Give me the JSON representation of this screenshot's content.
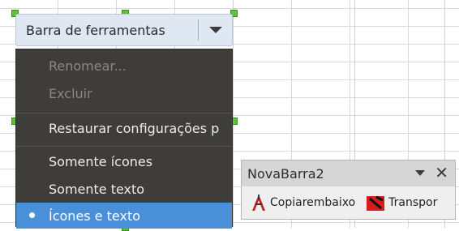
{
  "toolbar_combo": {
    "label": "Barra de ferramentas"
  },
  "menu": {
    "items": [
      {
        "text": "Renomear...",
        "state": "disabled"
      },
      {
        "text": "Excluir",
        "state": "disabled"
      },
      {
        "text": "Restaurar configurações p",
        "state": "enabled"
      },
      {
        "text": "Somente ícones",
        "state": "enabled"
      },
      {
        "text": "Somente texto",
        "state": "enabled"
      },
      {
        "text": "Ícones e texto",
        "state": "selected"
      }
    ]
  },
  "float_toolbar": {
    "title": "NovaBarra2",
    "tools": [
      {
        "icon": "copy-down-icon",
        "label": "Copiarembaixo"
      },
      {
        "icon": "transpose-icon",
        "label": "Transpor"
      }
    ]
  },
  "colors": {
    "menu_bg": "#3f3d39",
    "highlight": "#4a90d9",
    "selection_handle": "#5cc13c"
  }
}
